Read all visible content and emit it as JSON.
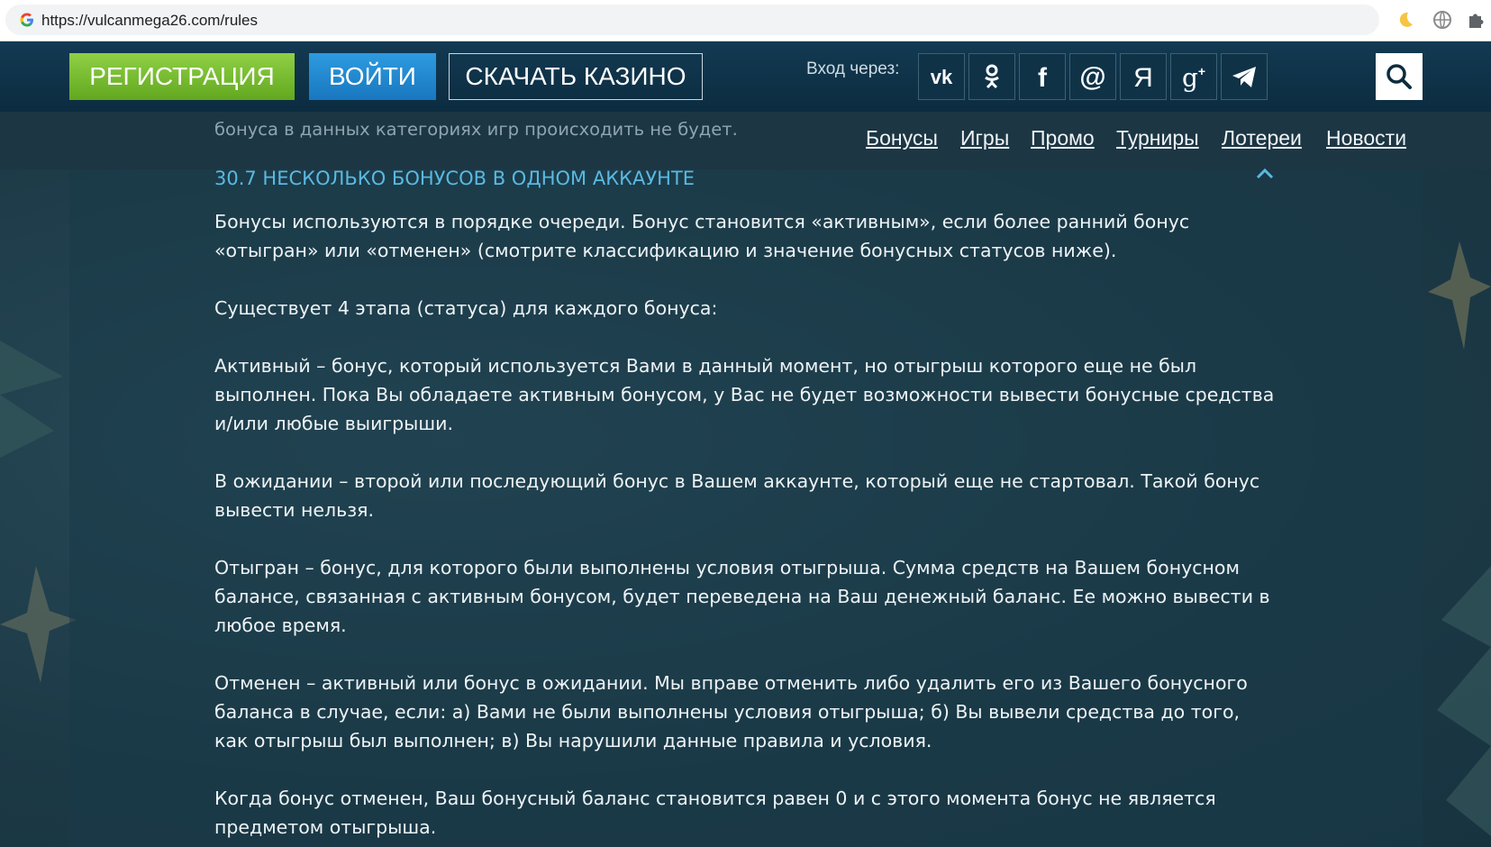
{
  "browser": {
    "url": "https://vulcanmega26.com/rules",
    "icons": [
      "google-icon",
      "moon-icon",
      "globe-icon",
      "puzzle-icon"
    ]
  },
  "header": {
    "register_label": "РЕГИСТРАЦИЯ",
    "login_label": "ВОЙТИ",
    "download_label": "СКАЧАТЬ КАЗИНО",
    "login_via": "Вход через:",
    "social": [
      "vk-icon",
      "odnoklassniki-icon",
      "facebook-icon",
      "mailru-icon",
      "yandex-icon",
      "googleplus-icon",
      "telegram-icon"
    ],
    "colors": {
      "register": "#7bbf32",
      "login": "#2389d2",
      "accent": "#5ab9e2"
    }
  },
  "nav": {
    "items": [
      "Бонусы",
      "Игры",
      "Промо",
      "Турниры",
      "Лотереи",
      "Новости"
    ]
  },
  "rules": {
    "peek_text": "бонуса в данных категориях игр происходить не будет.",
    "section_title": "30.7 НЕСКОЛЬКО БОНУСОВ В ОДНОМ АККАУНТЕ",
    "paragraphs": [
      "Бонусы используются в порядке очереди. Бонус становится «активным», если более ранний бонус «отыгран» или «отменен» (смотрите классификацию и значение бонусных статусов ниже).",
      "Существует 4 этапа (статуса) для каждого бонуса:",
      "Активный – бонус, который используется Вами в данный момент, но отыгрыш которого еще не был выполнен. Пока Вы обладаете активным бонусом, у Вас не будет возможности вывести бонусные средства и/или любые выигрыши.",
      "В ожидании – второй или последующий бонус в Вашем аккаунте, который еще не стартовал. Такой бонус вывести нельзя.",
      "Отыгран – бонус, для которого были выполнены условия отыгрыша. Сумма средств на Вашем бонусном балансе, связанная с активным бонусом, будет переведена на Ваш денежный баланс. Ее можно вывести в любое время.",
      "Отменен – активный или бонус в ожидании. Мы вправе отменить либо удалить его из Вашего бонусного баланса в случае, если: а) Вами не были выполнены условия отыгрыша; б) Вы вывели средства до того, как отыгрыш был выполнен; в) Вы нарушили данные правила и условия.",
      "Когда бонус отменен, Ваш бонусный баланс становится равен 0 и с этого момента бонус не является предметом отыгрыша."
    ]
  }
}
